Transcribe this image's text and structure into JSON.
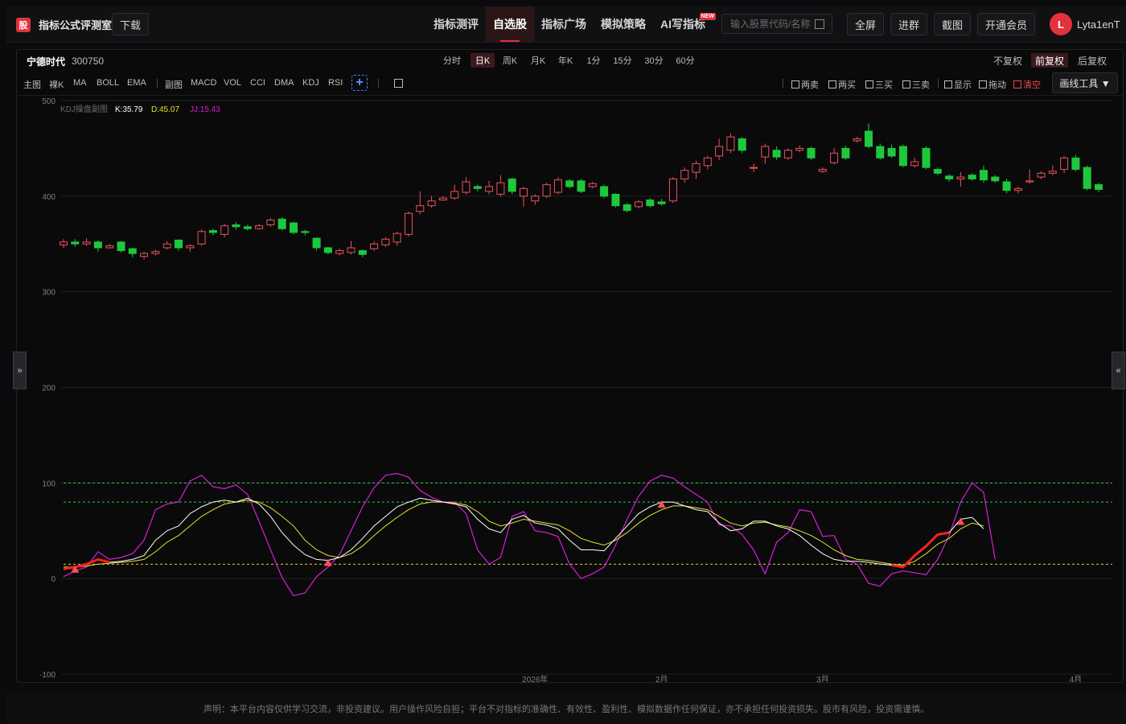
{
  "header": {
    "brand_icon": "股",
    "brand_title": "指标公式评测室",
    "download_label": "下载",
    "nav": [
      {
        "label": "指标测评",
        "active": false
      },
      {
        "label": "自选股",
        "active": true
      },
      {
        "label": "指标广场",
        "active": false
      },
      {
        "label": "模拟策略",
        "active": false
      },
      {
        "label": "AI写指标",
        "active": false,
        "badge": "NEW"
      }
    ],
    "search_placeholder": "输入股票代码/名称",
    "fullscreen_label": "全屏",
    "join_group_label": "进群",
    "screenshot_label": "截图",
    "vip_label": "开通会员",
    "avatar_letter": "L",
    "username": "Lyta1enT"
  },
  "stock": {
    "name": "宁德时代",
    "code": "300750"
  },
  "periods": [
    {
      "label": "分时",
      "active": false
    },
    {
      "label": "日K",
      "active": true
    },
    {
      "label": "周K",
      "active": false
    },
    {
      "label": "月K",
      "active": false
    },
    {
      "label": "年K",
      "active": false
    },
    {
      "label": "1分",
      "active": false
    },
    {
      "label": "15分",
      "active": false
    },
    {
      "label": "30分",
      "active": false
    },
    {
      "label": "60分",
      "active": false
    }
  ],
  "adjust": [
    {
      "label": "不复权",
      "active": false
    },
    {
      "label": "前复权",
      "active": true
    },
    {
      "label": "后复权",
      "active": false
    }
  ],
  "indicators": {
    "main_label": "主图",
    "main": [
      "裸K",
      "MA",
      "BOLL",
      "EMA"
    ],
    "sub_label": "副图",
    "sub": [
      "MACD",
      "VOL",
      "CCI",
      "DMA",
      "KDJ",
      "RSI"
    ],
    "add_label": "+"
  },
  "tools": [
    {
      "label": "两卖",
      "red": false
    },
    {
      "label": "两买",
      "red": false
    },
    {
      "label": "三买",
      "red": false
    },
    {
      "label": "三卖",
      "red": false
    },
    {
      "label": "显示",
      "red": false
    },
    {
      "label": "拖动",
      "red": false
    },
    {
      "label": "清空",
      "red": true
    }
  ],
  "draw_tools_label": "画线工具 ▼",
  "side_left": "»",
  "side_right": "«",
  "footer": "声明：本平台内容仅供学习交流，非投资建议。用户操作风险自担；平台不对指标的准确性、有效性、盈利性、模拟数据作任何保证，亦不承担任何投资损失。股市有风险，投资需谨慎。",
  "colors": {
    "up": "#f0505a",
    "down": "#1ec83c",
    "k": "#ffffff",
    "d": "#e5e52e",
    "j": "#d91ed9",
    "overbought": "#2ecc40",
    "oversold": "#e0d030",
    "buy_signal": "#ff4d5a"
  },
  "chart_data": {
    "type": "candlestick+kdj",
    "legend": {
      "name": "KDJ操盘副图",
      "k_label": "K:35.79",
      "d_label": "D:45.07",
      "j_label": "JJ:15.43"
    },
    "y_ticks": [
      500,
      400,
      300,
      200,
      100,
      0,
      -100
    ],
    "ylim": [
      -100,
      500
    ],
    "kdj_levels": {
      "overbought_high": 100,
      "overbought": 80,
      "oversold": 15
    },
    "x_labels": [
      {
        "index": 41,
        "label": "2026年"
      },
      {
        "index": 52,
        "label": "2月"
      },
      {
        "index": 66,
        "label": "3月"
      },
      {
        "index": 88,
        "label": "4月"
      }
    ],
    "candles": [
      [
        349,
        352,
        346,
        355
      ],
      [
        352,
        350,
        347,
        355
      ],
      [
        350,
        352,
        348,
        356
      ],
      [
        352,
        346,
        342,
        354
      ],
      [
        346,
        348,
        345,
        350
      ],
      [
        352,
        343,
        341,
        353
      ],
      [
        345,
        340,
        336,
        346
      ],
      [
        337,
        340,
        334,
        342
      ],
      [
        340,
        342,
        338,
        344
      ],
      [
        346,
        350,
        344,
        353
      ],
      [
        354,
        346,
        343,
        355
      ],
      [
        346,
        348,
        342,
        350
      ],
      [
        350,
        363,
        348,
        365
      ],
      [
        364,
        362,
        359,
        366
      ],
      [
        360,
        369,
        357,
        371
      ],
      [
        370,
        368,
        365,
        373
      ],
      [
        368,
        366,
        364,
        370
      ],
      [
        366,
        369,
        365,
        371
      ],
      [
        370,
        375,
        368,
        377
      ],
      [
        376,
        366,
        364,
        378
      ],
      [
        372,
        362,
        360,
        373
      ],
      [
        363,
        362,
        359,
        365
      ],
      [
        356,
        346,
        343,
        357
      ],
      [
        346,
        341,
        339,
        347
      ],
      [
        340,
        343,
        338,
        345
      ],
      [
        341,
        346,
        339,
        353
      ],
      [
        343,
        339,
        336,
        344
      ],
      [
        345,
        350,
        343,
        353
      ],
      [
        349,
        355,
        347,
        357
      ],
      [
        352,
        361,
        348,
        363
      ],
      [
        360,
        382,
        358,
        384
      ],
      [
        384,
        390,
        381,
        405
      ],
      [
        390,
        395,
        388,
        400
      ],
      [
        396,
        398,
        395,
        400
      ],
      [
        398,
        405,
        396,
        412
      ],
      [
        404,
        415,
        402,
        420
      ],
      [
        410,
        408,
        405,
        412
      ],
      [
        405,
        410,
        402,
        416
      ],
      [
        402,
        414,
        400,
        422
      ],
      [
        418,
        405,
        402,
        419
      ],
      [
        400,
        408,
        389,
        410
      ],
      [
        395,
        400,
        391,
        402
      ],
      [
        400,
        412,
        398,
        414
      ],
      [
        404,
        417,
        402,
        420
      ],
      [
        416,
        410,
        408,
        418
      ],
      [
        416,
        405,
        403,
        418
      ],
      [
        410,
        413,
        408,
        415
      ],
      [
        410,
        400,
        398,
        412
      ],
      [
        402,
        390,
        388,
        403
      ],
      [
        391,
        385,
        383,
        393
      ],
      [
        389,
        394,
        387,
        396
      ],
      [
        396,
        390,
        388,
        398
      ],
      [
        394,
        392,
        390,
        397
      ],
      [
        395,
        418,
        393,
        420
      ],
      [
        418,
        427,
        414,
        430
      ],
      [
        425,
        434,
        418,
        437
      ],
      [
        432,
        440,
        428,
        442
      ],
      [
        442,
        452,
        438,
        460
      ],
      [
        448,
        462,
        445,
        466
      ],
      [
        460,
        448,
        445,
        462
      ],
      [
        430,
        430,
        425,
        434
      ],
      [
        441,
        452,
        434,
        455
      ],
      [
        448,
        441,
        438,
        452
      ],
      [
        440,
        448,
        438,
        450
      ],
      [
        448,
        450,
        446,
        453
      ],
      [
        450,
        440,
        438,
        452
      ],
      [
        426,
        428,
        424,
        430
      ],
      [
        435,
        445,
        433,
        450
      ],
      [
        450,
        440,
        438,
        453
      ],
      [
        458,
        460,
        456,
        462
      ],
      [
        468,
        452,
        450,
        476
      ],
      [
        452,
        440,
        438,
        455
      ],
      [
        450,
        442,
        440,
        454
      ],
      [
        452,
        432,
        430,
        454
      ],
      [
        432,
        436,
        430,
        440
      ],
      [
        450,
        430,
        428,
        452
      ],
      [
        428,
        424,
        422,
        430
      ],
      [
        421,
        418,
        415,
        423
      ],
      [
        418,
        420,
        410,
        425
      ],
      [
        422,
        418,
        416,
        424
      ],
      [
        427,
        417,
        414,
        432
      ],
      [
        420,
        416,
        414,
        422
      ],
      [
        415,
        406,
        403,
        418
      ],
      [
        406,
        408,
        403,
        410
      ],
      [
        415,
        416,
        413,
        428
      ],
      [
        420,
        424,
        418,
        426
      ],
      [
        424,
        426,
        422,
        432
      ],
      [
        428,
        440,
        424,
        442
      ],
      [
        440,
        428,
        426,
        443
      ],
      [
        430,
        408,
        406,
        432
      ],
      [
        412,
        407,
        404,
        414
      ]
    ],
    "k": [
      10,
      12,
      15,
      20,
      17,
      18,
      20,
      24,
      40,
      50,
      55,
      68,
      75,
      80,
      82,
      80,
      84,
      78,
      65,
      48,
      35,
      25,
      20,
      19,
      22,
      30,
      42,
      55,
      65,
      75,
      80,
      84,
      82,
      80,
      78,
      75,
      62,
      52,
      48,
      62,
      66,
      58,
      56,
      52,
      40,
      30,
      30,
      29,
      42,
      55,
      68,
      75,
      80,
      80,
      76,
      72,
      70,
      58,
      50,
      52,
      60,
      60,
      55,
      52,
      45,
      35,
      26,
      20,
      18,
      18,
      17,
      15,
      14,
      12,
      24,
      34,
      46,
      48,
      62,
      64,
      52
    ],
    "d": [
      12,
      12,
      13,
      15,
      16,
      17,
      18,
      20,
      28,
      38,
      45,
      55,
      65,
      72,
      78,
      80,
      82,
      80,
      74,
      65,
      55,
      40,
      30,
      24,
      22,
      26,
      34,
      45,
      55,
      64,
      72,
      78,
      80,
      80,
      79,
      77,
      70,
      60,
      55,
      58,
      62,
      60,
      58,
      56,
      50,
      42,
      38,
      35,
      40,
      48,
      58,
      66,
      72,
      76,
      76,
      74,
      72,
      65,
      58,
      55,
      58,
      59,
      56,
      54,
      50,
      45,
      38,
      30,
      24,
      20,
      19,
      17,
      15,
      14,
      18,
      26,
      36,
      42,
      52,
      58,
      55
    ],
    "j": [
      2,
      8,
      12,
      28,
      20,
      22,
      26,
      40,
      72,
      78,
      80,
      102,
      108,
      96,
      94,
      98,
      88,
      60,
      30,
      1,
      -18,
      -15,
      2,
      12,
      25,
      50,
      75,
      95,
      108,
      110,
      106,
      92,
      85,
      80,
      80,
      68,
      30,
      15,
      22,
      65,
      70,
      50,
      48,
      44,
      15,
      0,
      5,
      12,
      35,
      62,
      86,
      102,
      108,
      105,
      96,
      88,
      80,
      56,
      55,
      46,
      30,
      5,
      38,
      48,
      72,
      70,
      44,
      45,
      20,
      15,
      -5,
      -8,
      5,
      8,
      6,
      4,
      20,
      45,
      80,
      100,
      90,
      20
    ],
    "buy_signals": [
      1,
      23,
      52,
      78
    ],
    "red_segments": [
      [
        0,
        4
      ],
      [
        72,
        77
      ]
    ]
  }
}
